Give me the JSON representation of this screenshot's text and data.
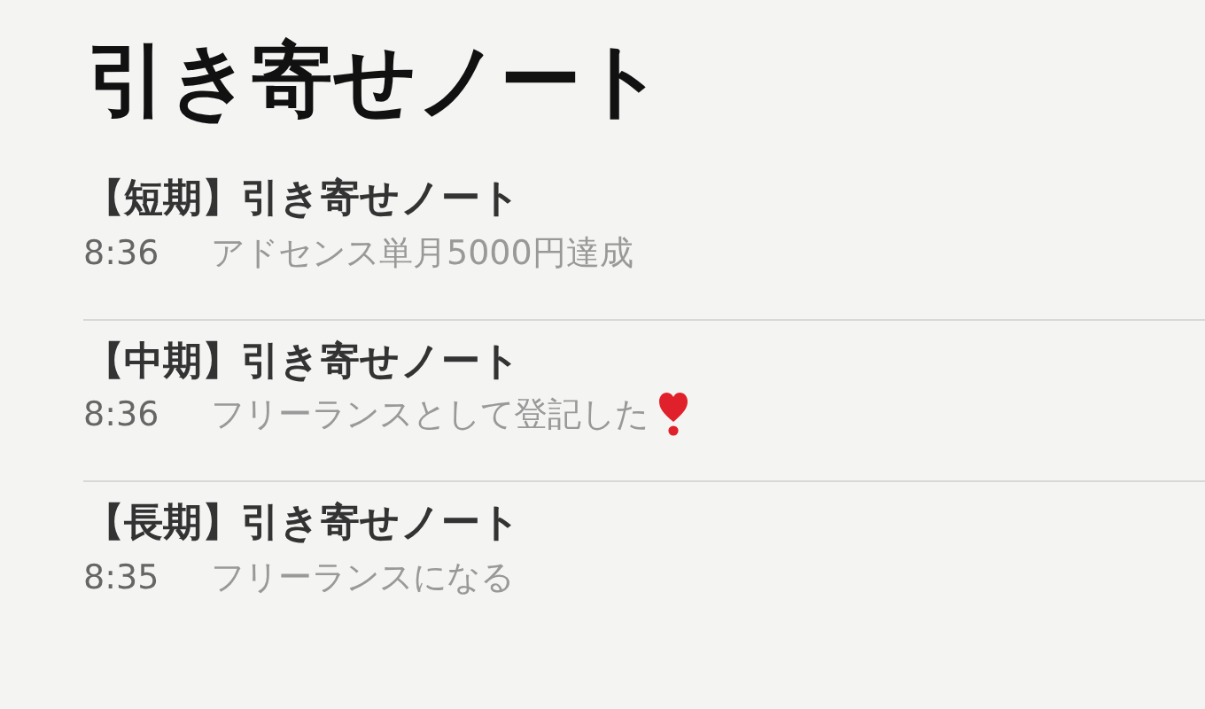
{
  "title": "引き寄せノート",
  "notes": [
    {
      "title": "【短期】引き寄せノート",
      "time": "8:36",
      "preview": "アドセンス単月5000円達成",
      "heart": false
    },
    {
      "title": "【中期】引き寄せノート",
      "time": "8:36",
      "preview": "フリーランスとして登記した",
      "heart": true
    },
    {
      "title": "【長期】引き寄せノート",
      "time": "8:35",
      "preview": "フリーランスになる",
      "heart": false
    }
  ]
}
